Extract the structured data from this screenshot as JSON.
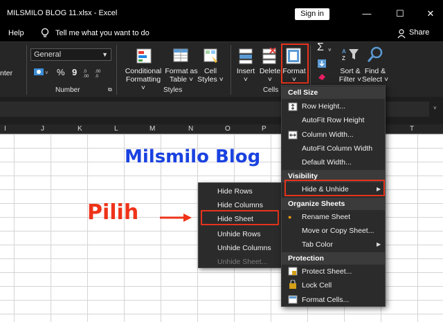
{
  "window": {
    "title": "MILSMILO BLOG 11.xlsx  -  Excel",
    "signin_label": "Sign in",
    "minimize": "—",
    "restore": "☐",
    "close": "✕"
  },
  "menubar": {
    "help": "Help",
    "tell_me": "Tell me what you want to do",
    "share": "Share"
  },
  "ribbon": {
    "partial_left_label": "nter",
    "number_format_value": "General",
    "percent_symbol": "%",
    "comma_symbol": "9",
    "groups": {
      "number": "Number",
      "styles": "Styles",
      "cells": "Cells"
    },
    "buttons": {
      "conditional_formatting": [
        "Conditional",
        "Formatting ˅"
      ],
      "format_as_table": [
        "Format as",
        "Table ˅"
      ],
      "cell_styles": [
        "Cell",
        "Styles ˅"
      ],
      "insert": [
        "Insert",
        "˅"
      ],
      "delete": [
        "Delete",
        "˅"
      ],
      "format": [
        "Format",
        "˅"
      ],
      "sort_filter": [
        "Sort &",
        "Filter ˅"
      ],
      "find_select": [
        "Find &",
        "Select ˅"
      ]
    }
  },
  "columns": [
    "I",
    "J",
    "K",
    "L",
    "M",
    "N",
    "O",
    "P",
    "T"
  ],
  "sheet": {
    "blog_title": "Milsmilo Blog",
    "pilih": "Pilih"
  },
  "hide_submenu": [
    {
      "label": "Hide Rows",
      "enabled": true
    },
    {
      "label": "Hide Columns",
      "enabled": true
    },
    {
      "label": "Hide Sheet",
      "enabled": true,
      "highlighted": true
    },
    {
      "label": "Unhide Rows",
      "enabled": true
    },
    {
      "label": "Unhide Columns",
      "enabled": true
    },
    {
      "label": "Unhide Sheet...",
      "enabled": false
    }
  ],
  "format_menu": {
    "cell_size_header": "Cell Size",
    "row_height": "Row Height...",
    "autofit_row": "AutoFit Row Height",
    "column_width": "Column Width...",
    "autofit_column": "AutoFit Column Width",
    "default_width": "Default Width...",
    "visibility_header": "Visibility",
    "hide_unhide": "Hide & Unhide",
    "organize_header": "Organize Sheets",
    "rename_sheet": "Rename Sheet",
    "move_copy": "Move or Copy Sheet...",
    "tab_color": "Tab Color",
    "protection_header": "Protection",
    "protect_sheet": "Protect Sheet...",
    "lock_cell": "Lock Cell",
    "format_cells": "Format Cells..."
  },
  "colors": {
    "titlebar": "#000000",
    "ribbon": "#262626",
    "menu_bg": "#2b2b2b",
    "highlight_border": "#e8331c",
    "blog_title": "#1a42e0",
    "pilih": "#ee3319"
  }
}
